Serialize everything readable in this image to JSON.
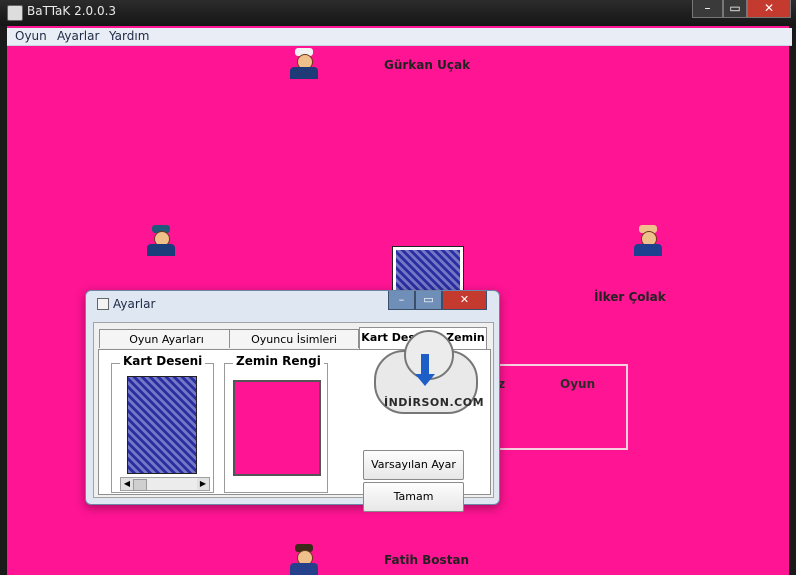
{
  "window": {
    "title": "BaTTaK  2.0.0.3"
  },
  "menu": [
    "Oyun",
    "Ayarlar",
    "Yardım"
  ],
  "players": {
    "top": "Gürkan Uçak",
    "right": "İlker Çolak",
    "bottom": "Fatih Bostan"
  },
  "scoreboard": {
    "col1": "ız",
    "col2": "Oyun"
  },
  "dialog": {
    "title": "Ayarlar",
    "tabs": [
      "Oyun Ayarları",
      "Oyuncu İsimleri",
      "Kart Deseni - Zemin"
    ],
    "groups": {
      "card": "Kart Deseni",
      "background": "Zemin Rengi"
    },
    "buttons": {
      "reset": "Varsayılan Ayar",
      "ok": "Tamam"
    }
  },
  "watermark": "İNDİRSON.COM",
  "colors": {
    "background": "#ff1493",
    "card_back": "#2a2ea3"
  },
  "icons": [
    "app-icon",
    "minimize-icon",
    "maximize-icon",
    "close-icon"
  ]
}
